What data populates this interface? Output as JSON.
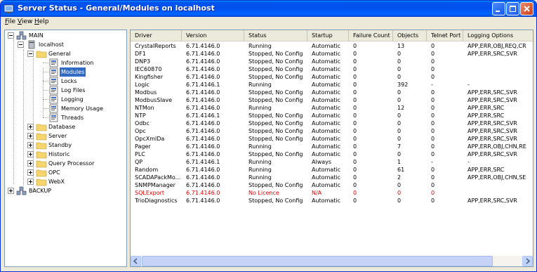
{
  "window": {
    "title": "Server Status - General/Modules on localhost"
  },
  "menu": [
    {
      "key": "F",
      "rest": "ile"
    },
    {
      "key": "V",
      "rest": "iew"
    },
    {
      "key": "H",
      "rest": "elp"
    }
  ],
  "tree": {
    "main": "MAIN",
    "localhost": "localhost",
    "general": "General",
    "general_children": [
      "Information",
      "Modules",
      "Locks",
      "Log Files",
      "Logging",
      "Memory Usage",
      "Threads"
    ],
    "siblings": [
      "Database",
      "Server",
      "Standby",
      "Historic",
      "Query Processor",
      "OPC",
      "WebX"
    ],
    "backup": "BACKUP",
    "selected": "Modules"
  },
  "table": {
    "columns": [
      "Driver",
      "Version",
      "Status",
      "Startup",
      "Failure Count",
      "Objects",
      "Telnet Port",
      "Logging Options"
    ],
    "rows": [
      [
        "CrystalReports",
        "6.71.4146.0",
        "Running",
        "Automatic",
        "0",
        "13",
        "0",
        "APP,ERR,OBJ,REQ,CR"
      ],
      [
        "DF1",
        "6.71.4146.0",
        "Stopped, No Config",
        "Automatic",
        "0",
        "0",
        "0",
        "APP,ERR,SRC,SVR"
      ],
      [
        "DNP3",
        "6.71.4146.0",
        "Stopped, No Config",
        "Automatic",
        "0",
        "0",
        "0",
        ""
      ],
      [
        "IEC60870",
        "6.71.4146.0",
        "Stopped, No Config",
        "Automatic",
        "0",
        "0",
        "0",
        ""
      ],
      [
        "Kingfisher",
        "6.71.4146.0",
        "Stopped, No Config",
        "Automatic",
        "0",
        "0",
        "0",
        ""
      ],
      [
        "Logic",
        "6.71.4146.1",
        "Running",
        "Automatic",
        "0",
        "392",
        "-",
        "-"
      ],
      [
        "Modbus",
        "6.71.4146.0",
        "Stopped, No Config",
        "Automatic",
        "0",
        "0",
        "0",
        "APP,ERR,SRC,SVR"
      ],
      [
        "ModbusSlave",
        "6.71.4146.0",
        "Stopped, No Config",
        "Automatic",
        "0",
        "0",
        "0",
        "APP,ERR,SRC,SVR"
      ],
      [
        "NTMon",
        "6.71.4146.0",
        "Running",
        "Automatic",
        "0",
        "12",
        "0",
        "APP,ERR,SRC"
      ],
      [
        "NTP",
        "6.71.4146.1",
        "Stopped, No Config",
        "Automatic",
        "0",
        "0",
        "0",
        "APP,ERR,SRC"
      ],
      [
        "Odbc",
        "6.71.4146.0",
        "Stopped, No Config",
        "Automatic",
        "0",
        "0",
        "0",
        "APP,ERR,SRC,SVR"
      ],
      [
        "Opc",
        "6.71.4146.0",
        "Stopped, No Config",
        "Automatic",
        "0",
        "0",
        "0",
        "APP,ERR,SRC,SVR"
      ],
      [
        "OpcXmlDa",
        "6.71.4146.0",
        "Stopped, No Config",
        "Automatic",
        "0",
        "0",
        "0",
        "APP,ERR,SRC,SVR"
      ],
      [
        "Pager",
        "6.71.4146.0",
        "Running",
        "Automatic",
        "0",
        "7",
        "0",
        "APP,ERR,OBJ,CHN,RE"
      ],
      [
        "PLC",
        "6.71.4146.0",
        "Stopped, No Config",
        "Automatic",
        "0",
        "0",
        "0",
        "APP,ERR,SRC,SVR"
      ],
      [
        "QP",
        "6.71.4146.1",
        "Running",
        "Always",
        "0",
        "1",
        "-",
        "-"
      ],
      [
        "Random",
        "6.71.4146.0",
        "Running",
        "Automatic",
        "0",
        "61",
        "0",
        "APP,ERR,SRC"
      ],
      [
        "SCADAPackMo...",
        "6.71.4146.0",
        "Running",
        "Automatic",
        "0",
        "2",
        "0",
        "APP,ERR,OBJ,CHN,SE"
      ],
      [
        "SNMPManager",
        "6.71.4146.0",
        "Stopped, No Config",
        "Automatic",
        "0",
        "0",
        "0",
        ""
      ],
      [
        "SQLExport",
        "6.71.4146.0",
        "No Licence",
        "N/A",
        "0",
        "0",
        "0",
        ""
      ],
      [
        "TrioDiagnostics",
        "6.71.4146.0",
        "Stopped, No Config",
        "Automatic",
        "0",
        "0",
        "0",
        "APP,ERR,SRC,SVR"
      ]
    ],
    "error_row": "SQLExport"
  },
  "colors": {
    "title_blue": "#0053ee",
    "selection": "#316ac5",
    "error_text": "#e00000"
  }
}
